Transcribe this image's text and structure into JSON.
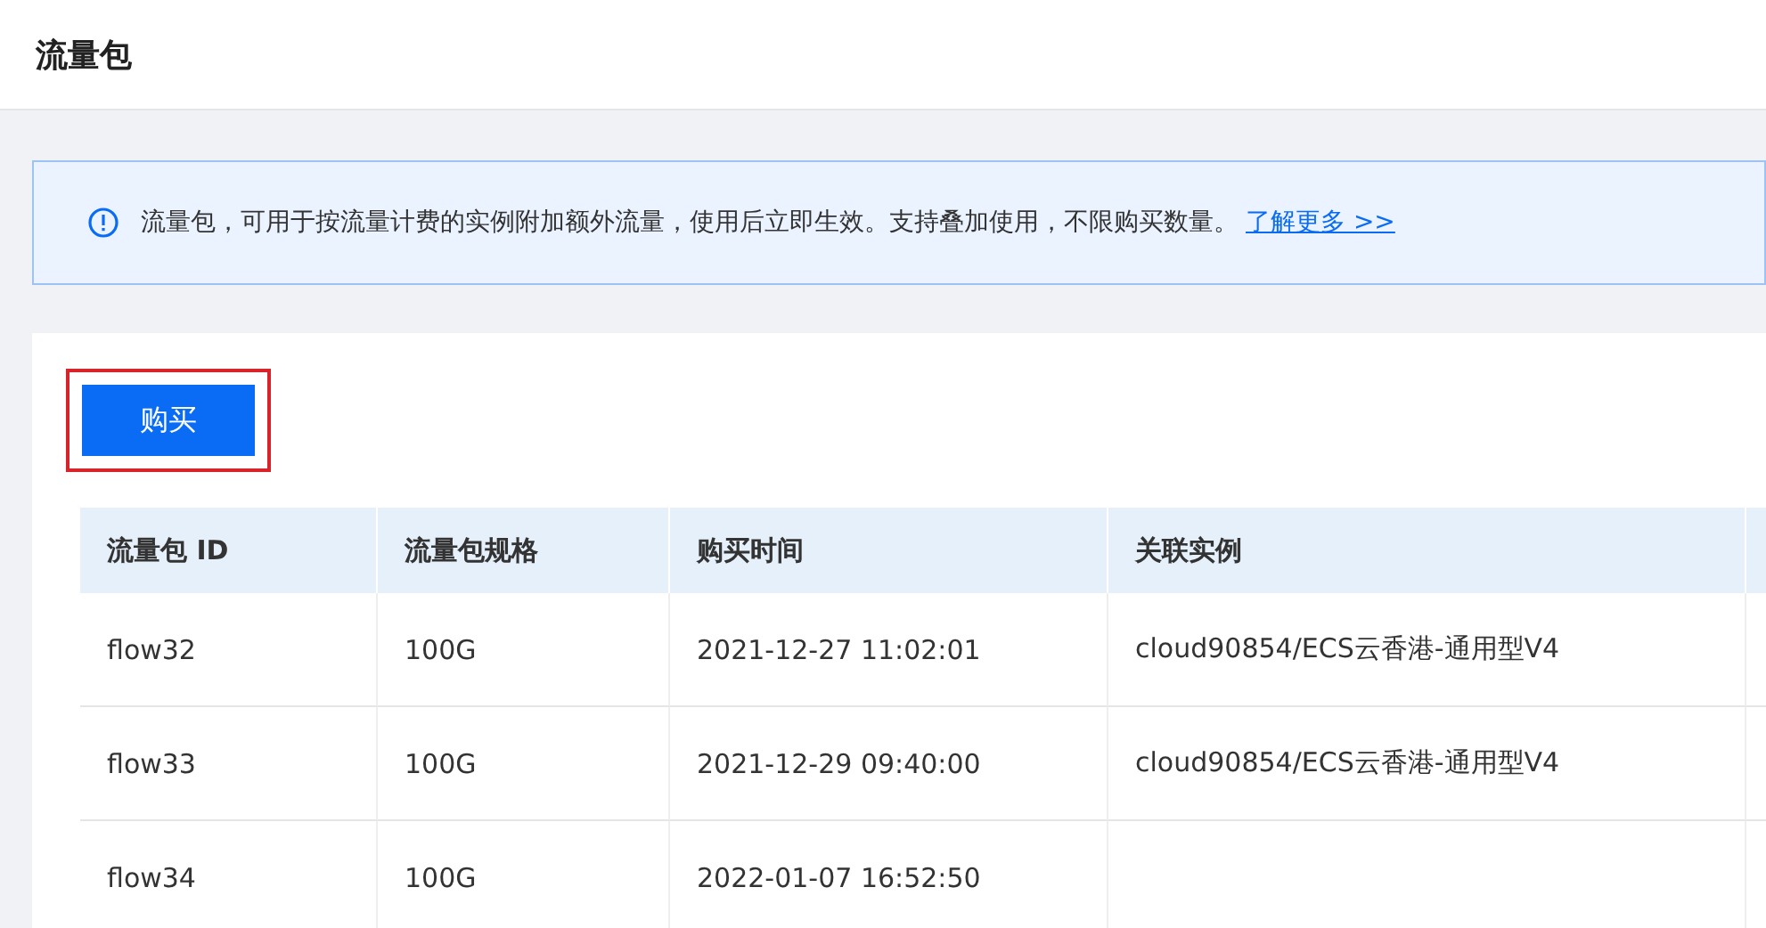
{
  "page": {
    "title": "流量包"
  },
  "notice": {
    "text": "流量包，可用于按流量计费的实例附加额外流量，使用后立即生效。支持叠加使用，不限购买数量。",
    "link": "了解更多 >>"
  },
  "toolbar": {
    "buy_button": "购买",
    "highlighted": true
  },
  "table": {
    "columns": [
      "流量包 ID",
      "流量包规格",
      "购买时间",
      "关联实例"
    ],
    "rows": [
      {
        "cells": [
          "flow32",
          "100G",
          "2021-12-27 11:02:01",
          "cloud90854/ECS云香港-通用型V4"
        ]
      },
      {
        "cells": [
          "flow33",
          "100G",
          "2021-12-29 09:40:00",
          "cloud90854/ECS云香港-通用型V4"
        ]
      },
      {
        "cells": [
          "flow34",
          "100G",
          "2022-01-07 16:52:50"
        ]
      }
    ]
  }
}
